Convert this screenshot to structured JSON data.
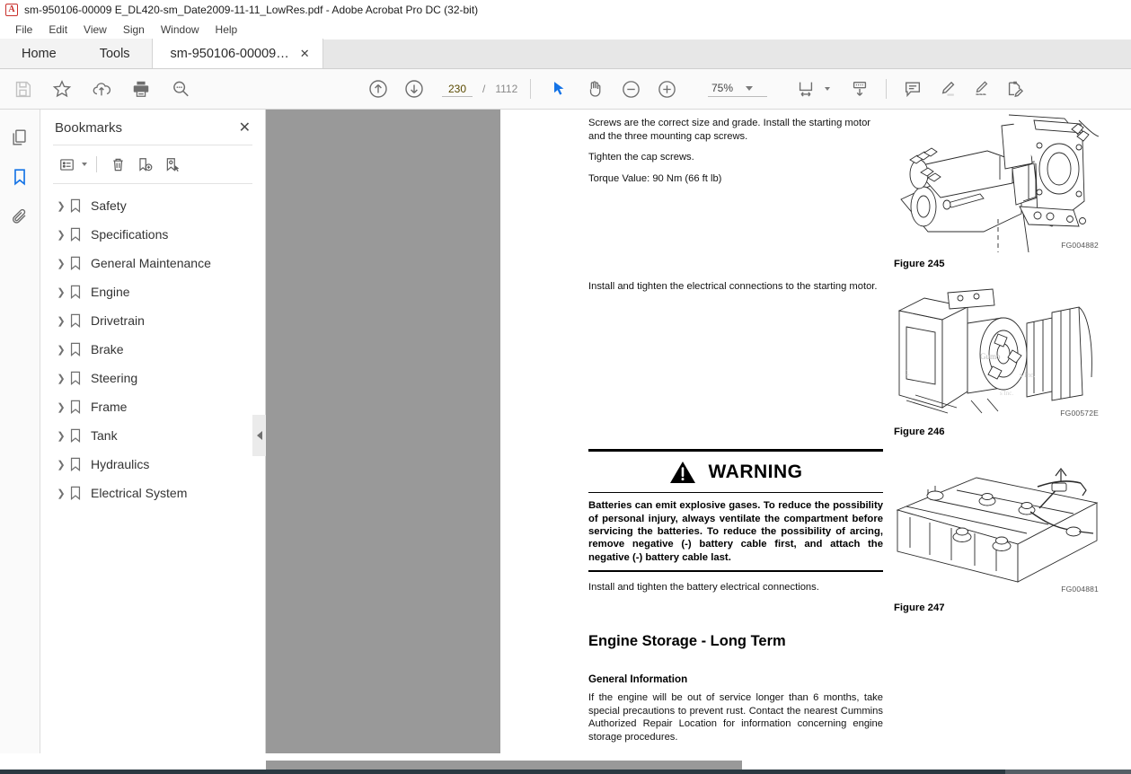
{
  "window": {
    "title": "sm-950106-00009 E_DL420-sm_Date2009-11-11_LowRes.pdf - Adobe Acrobat Pro DC (32-bit)",
    "app_icon": "acrobat-icon"
  },
  "menubar": {
    "items": [
      "File",
      "Edit",
      "View",
      "Sign",
      "Window",
      "Help"
    ]
  },
  "tabs": {
    "home": "Home",
    "tools": "Tools",
    "document": "sm-950106-00009…",
    "close": "✕"
  },
  "toolbar": {
    "left_icons": [
      "save-icon",
      "star-icon",
      "cloud-upload-icon",
      "print-icon",
      "search-icon"
    ],
    "page_current": "230",
    "page_separator": "/",
    "page_total": "1112",
    "nav_icons": [
      "previous-page-icon",
      "next-page-icon"
    ],
    "tools": [
      "select-tool-icon",
      "hand-tool-icon",
      "zoom-out-icon",
      "zoom-in-icon"
    ],
    "zoom_level": "75%",
    "right_icons": [
      "fit-width-icon",
      "scroll-mode-icon",
      "comment-icon",
      "highlight-icon",
      "sign-icon",
      "fill-and-sign-icon"
    ],
    "accent_color": "#1473e6"
  },
  "rail": {
    "items": [
      "page-thumbnails-icon",
      "bookmarks-icon",
      "attachments-icon"
    ],
    "active": "bookmarks-icon"
  },
  "bookmarks_panel": {
    "title": "Bookmarks",
    "close_label": "✕",
    "toolbar_icons": [
      "bookmark-options-icon",
      "delete-bookmark-icon",
      "new-bookmark-icon",
      "goto-bookmark-icon"
    ],
    "items": [
      {
        "label": "Safety"
      },
      {
        "label": "Specifications"
      },
      {
        "label": "General Maintenance"
      },
      {
        "label": "Engine"
      },
      {
        "label": "Drivetrain"
      },
      {
        "label": "Brake"
      },
      {
        "label": "Steering"
      },
      {
        "label": "Frame"
      },
      {
        "label": "Tank"
      },
      {
        "label": "Hydraulics"
      },
      {
        "label": "Electrical System"
      }
    ]
  },
  "document": {
    "paragraph_1": "Screws are the correct size and grade. Install the starting motor and the three mounting cap screws.",
    "paragraph_2": "Tighten the cap screws.",
    "paragraph_3": "Torque Value: 90 Nm (66 ft lb)",
    "paragraph_4": "Install and tighten the electrical connections to the starting motor.",
    "warning": {
      "title": "WARNING",
      "icon": "warning-triangle-icon",
      "body": "Batteries can emit explosive gases. To reduce the possibility of personal injury, always ventilate the compartment before servicing the batteries. To reduce the possibility of arcing, remove negative (-) battery cable first, and attach the negative (-) battery cable last."
    },
    "paragraph_5": "Install and tighten the battery electrical connections.",
    "heading_1": "Engine Storage - Long Term",
    "heading_2": "General Information",
    "paragraph_6": "If the engine will be out of service longer than 6 months, take special precautions to prevent rust. Contact the nearest Cummins Authorized Repair Location for information concerning engine storage procedures.",
    "figures": [
      {
        "caption": "Figure 245",
        "code": "FG004882",
        "alt": "starting-motor-installation-diagram"
      },
      {
        "caption": "Figure 246",
        "code": "FG00572E",
        "alt": "starting-motor-electrical-connections-diagram"
      },
      {
        "caption": "Figure 247",
        "code": "FG004881",
        "alt": "battery-electrical-connections-diagram"
      }
    ]
  }
}
